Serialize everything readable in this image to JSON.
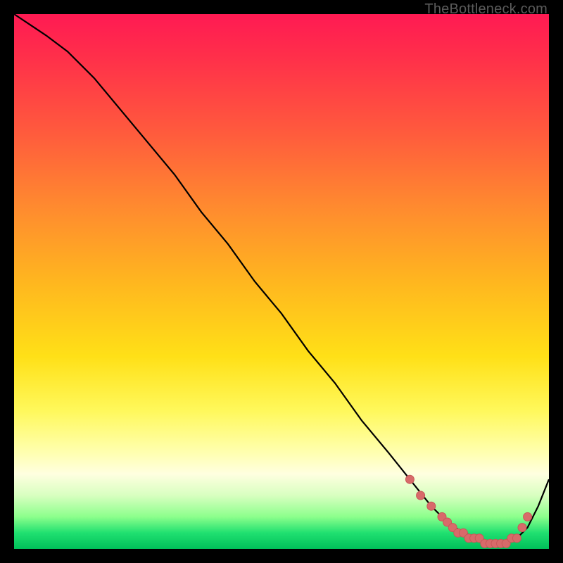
{
  "watermark": "TheBottleneck.com",
  "colors": {
    "curve_stroke": "#000000",
    "marker_fill": "#d86a6a",
    "marker_stroke": "#c85858"
  },
  "chart_data": {
    "type": "line",
    "title": "",
    "xlabel": "",
    "ylabel": "",
    "xlim": [
      0,
      100
    ],
    "ylim": [
      0,
      100
    ],
    "grid": false,
    "legend": false,
    "series": [
      {
        "name": "bottleneck-curve",
        "x": [
          0,
          3,
          6,
          10,
          15,
          20,
          25,
          30,
          35,
          40,
          45,
          50,
          55,
          60,
          65,
          70,
          74,
          78,
          81,
          84,
          87,
          90,
          92,
          94,
          96,
          98,
          100
        ],
        "values": [
          100,
          98,
          96,
          93,
          88,
          82,
          76,
          70,
          63,
          57,
          50,
          44,
          37,
          31,
          24,
          18,
          13,
          8,
          5,
          3,
          2,
          1,
          1,
          2,
          4,
          8,
          13
        ]
      }
    ],
    "markers": {
      "name": "flat-region-dots",
      "x": [
        74,
        76,
        78,
        80,
        81,
        82,
        83,
        84,
        85,
        86,
        87,
        88,
        89,
        90,
        91,
        92,
        93,
        94,
        95,
        96
      ],
      "values": [
        13,
        10,
        8,
        6,
        5,
        4,
        3,
        3,
        2,
        2,
        2,
        1,
        1,
        1,
        1,
        1,
        2,
        2,
        4,
        6
      ]
    }
  }
}
